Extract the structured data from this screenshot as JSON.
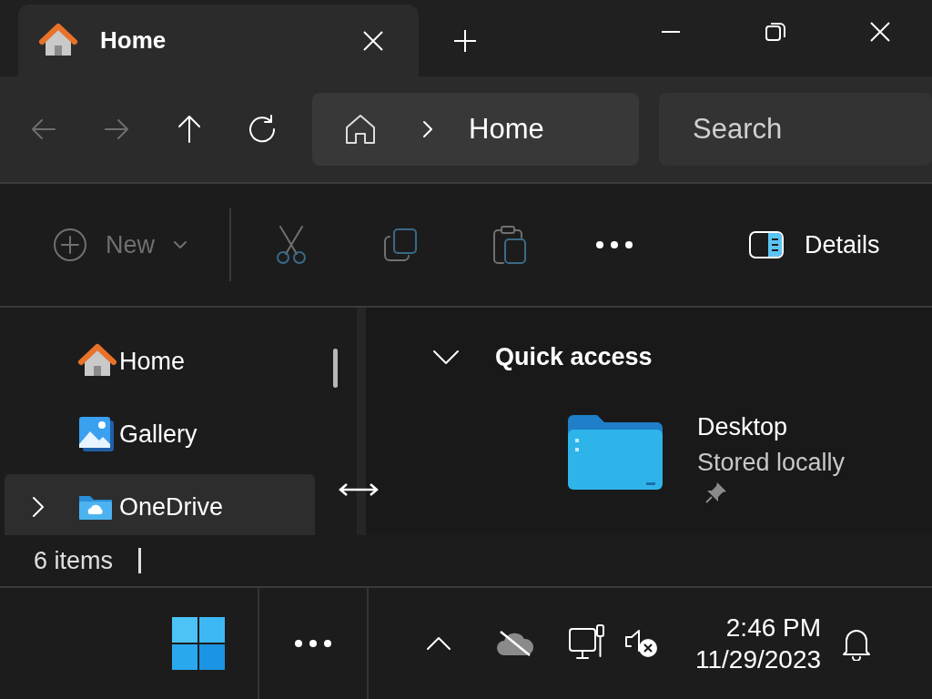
{
  "tabs": [
    {
      "label": "Home",
      "selected": true
    }
  ],
  "nav_buttons": [
    {
      "kind": "back",
      "disabled": true
    },
    {
      "kind": "forward",
      "disabled": true
    },
    {
      "kind": "up",
      "disabled": false
    },
    {
      "kind": "refresh",
      "disabled": false
    }
  ],
  "address": {
    "breadcrumb": [
      "Home"
    ],
    "search_placeholder": "Search"
  },
  "commands": [
    {
      "kind": "new",
      "label": "New",
      "disabled": true
    },
    {
      "kind": "cut",
      "disabled": true
    },
    {
      "kind": "copy",
      "disabled": true
    },
    {
      "kind": "paste",
      "disabled": true
    },
    {
      "kind": "more",
      "disabled": false
    },
    {
      "kind": "details",
      "label": "Details",
      "disabled": false
    }
  ],
  "sidebar": {
    "items": [
      {
        "kind": "home",
        "label": "Home",
        "selected": false
      },
      {
        "kind": "gallery",
        "label": "Gallery",
        "selected": false
      },
      {
        "kind": "onedrive",
        "label": "OneDrive",
        "selected": true,
        "expanded": false
      }
    ]
  },
  "content": {
    "section": {
      "title": "Quick access",
      "expanded": true
    },
    "items": [
      {
        "name": "Desktop",
        "detail": "Stored locally",
        "pinned": true
      }
    ]
  },
  "status_bar": {
    "item_count": "6 items"
  },
  "taskbar": {
    "time": "2:46 PM",
    "date": "11/29/2023"
  }
}
